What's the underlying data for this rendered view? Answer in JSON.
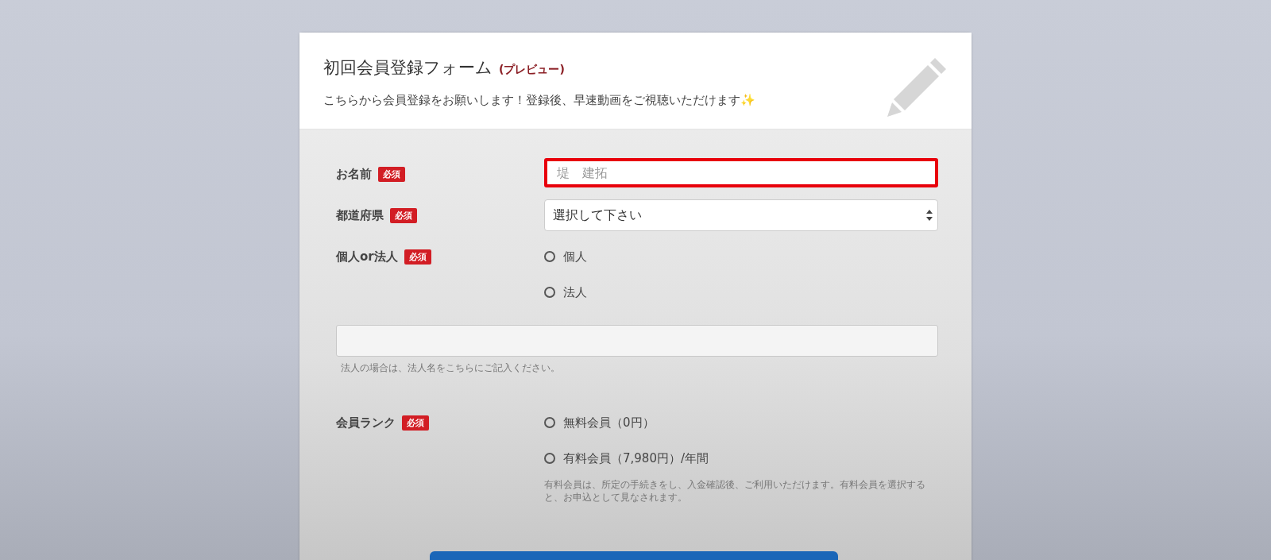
{
  "header": {
    "title": "初回会員登録フォーム",
    "title_tag": "(プレビュー)",
    "subtitle": "こちらから会員登録をお願いします！登録後、早速動画をご視聴いただけます✨"
  },
  "fields": [
    {
      "kind": "text",
      "label": "お名前",
      "required_badge": "必須",
      "placeholder": "堤　建拓",
      "error": true
    },
    {
      "kind": "select",
      "label": "都道府県",
      "required_badge": "必須",
      "value": "選択して下さい"
    },
    {
      "kind": "radio",
      "label": "個人or法人",
      "required_badge": "必須",
      "options": [
        {
          "label": "個人",
          "selected": false
        },
        {
          "label": "法人",
          "selected": false
        }
      ]
    },
    {
      "kind": "wide_text",
      "help": "法人の場合は、法人名をこちらにご記入ください。"
    },
    {
      "kind": "radio",
      "label": "会員ランク",
      "required_badge": "必須",
      "options": [
        {
          "label": "無料会員（0円）",
          "selected": false
        },
        {
          "label": "有料会員（7,980円）/年間",
          "selected": false
        }
      ],
      "note": "有料会員は、所定の手続きをし、入金確認後、ご利用いただけます。有料会員を選択すると、お申込として見なされます。"
    }
  ],
  "submit": {
    "kind": "button"
  }
}
